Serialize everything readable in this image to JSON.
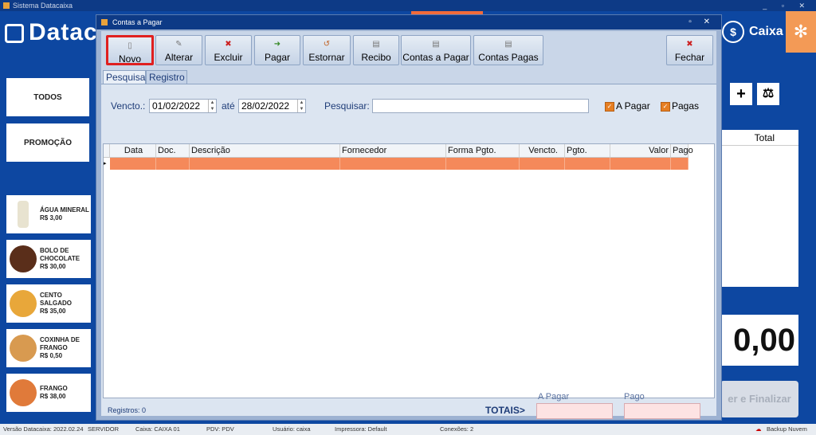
{
  "app": {
    "window_title": "Sistema Datacaixa",
    "window_controls": "_ ▫ ✕",
    "logo_text": "Datac",
    "caixa_label": "Caixa",
    "caixa_icon": "$",
    "gear_icon": "✻"
  },
  "categories": [
    {
      "label": "TODOS"
    },
    {
      "label": "PROMOÇÃO"
    }
  ],
  "products": [
    {
      "name": "ÁGUA MINERAL",
      "price": "R$ 3,00",
      "color": "#e8e3d0"
    },
    {
      "name": "BOLO DE CHOCOLATE",
      "price": "R$ 30,00",
      "color": "#5a2e1a"
    },
    {
      "name": "CENTO SALGADO",
      "price": "R$ 35,00",
      "color": "#e8a73a"
    },
    {
      "name": "COXINHA DE FRANGO",
      "price": "R$ 0,50",
      "color": "#d89a50"
    },
    {
      "name": "FRANGO",
      "price": "R$ 38,00",
      "color": "#e07a3a"
    }
  ],
  "right_panel": {
    "total_header": "Total",
    "plus_label": "+",
    "scale_label": "⚖",
    "big_total": "0,00",
    "finalize_label": "er e Finalizar"
  },
  "statusbar": {
    "version": "Versão Datacaixa: 2022.02.24",
    "server": "SERVIDOR",
    "caixa": "Caixa: CAIXA 01",
    "pdv": "PDV: PDV",
    "user": "Usuário: caixa",
    "printer": "Impressora: Default",
    "connections": "Conexões: 2",
    "backup": "Backup Nuvem"
  },
  "dialog": {
    "title": "Contas a Pagar",
    "controls": "▫ ✕",
    "toolbar": [
      {
        "id": "novo",
        "label": "Novo",
        "icon": "▯"
      },
      {
        "id": "alterar",
        "label": "Alterar",
        "icon": "✎"
      },
      {
        "id": "excluir",
        "label": "Excluir",
        "icon": "✖"
      },
      {
        "id": "pagar",
        "label": "Pagar",
        "icon": "➜"
      },
      {
        "id": "estornar",
        "label": "Estornar",
        "icon": "↺"
      },
      {
        "id": "recibo",
        "label": "Recibo",
        "icon": "▤"
      },
      {
        "id": "contas_a_pagar",
        "label": "Contas a Pagar",
        "icon": "▤"
      },
      {
        "id": "contas_pagas",
        "label": "Contas Pagas",
        "icon": "▤"
      },
      {
        "id": "fechar",
        "label": "Fechar",
        "icon": "✖"
      }
    ],
    "tabs": [
      {
        "label": "Pesquisa",
        "active": true
      },
      {
        "label": "Registro",
        "active": false
      }
    ],
    "filters": {
      "vencto_label": "Vencto.:",
      "date_from": "01/02/2022",
      "ate_label": "até",
      "date_to": "28/02/2022",
      "search_label": "Pesquisar:",
      "search_value": "",
      "check_a_pagar": "A Pagar",
      "check_pagas": "Pagas"
    },
    "grid": {
      "columns": [
        "Data",
        "Doc.",
        "Descrição",
        "Fornecedor",
        "Forma Pgto.",
        "Vencto.",
        "Pgto.",
        "Valor",
        "Pago"
      ],
      "row_color": "#f5895a"
    },
    "footer": {
      "registros": "Registros: 0",
      "totais": "TOTAIS>",
      "a_pagar_label": "A Pagar",
      "pago_label": "Pago"
    }
  }
}
